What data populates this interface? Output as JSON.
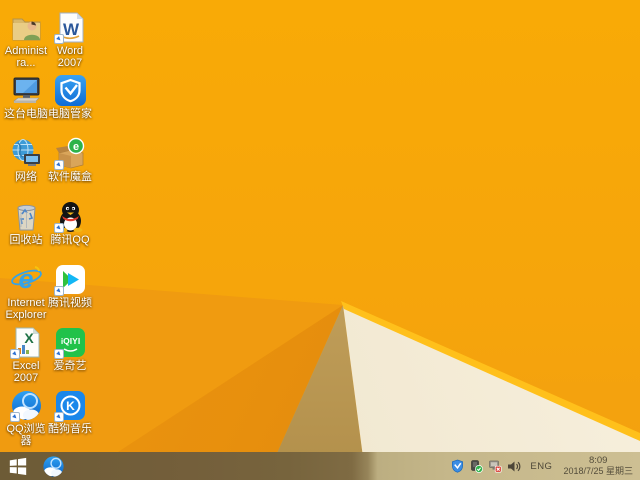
{
  "colors": {
    "wallpaper_orange": "#f7a60a",
    "wallpaper_orange_dark": "#e0860a",
    "wallpaper_tan": "#c2a05c",
    "wallpaper_cream": "#f2e9d2",
    "fold_highlight": "#ffc01b",
    "taskbar_left": "#6d5b36",
    "taskbar_right": "#cdbf93",
    "icon_label_text": "#ffffff"
  },
  "desktop": {
    "columns": [
      {
        "items": [
          {
            "label": "Administra..."
          },
          {
            "label": "这台电脑"
          },
          {
            "label": "网络"
          },
          {
            "label": "回收站"
          },
          {
            "label": "Internet Explorer"
          },
          {
            "label": "Excel 2007"
          },
          {
            "label": "QQ浏览器"
          }
        ]
      },
      {
        "items": [
          {
            "label": "Word 2007"
          },
          {
            "label": "电脑管家"
          },
          {
            "label": "软件魔盒"
          },
          {
            "label": "腾讯QQ"
          },
          {
            "label": "腾讯视频"
          },
          {
            "label": "爱奇艺"
          },
          {
            "label": "酷狗音乐"
          }
        ]
      }
    ],
    "glyphs": {
      "word": "W",
      "excel": "X",
      "ie": "e",
      "softbox": "e",
      "iqiyi": "iQIYI",
      "kugou": "K"
    }
  },
  "taskbar": {
    "tray": {
      "language": "ENG",
      "time": "8:09",
      "date": "2018/7/25 星期三"
    }
  }
}
